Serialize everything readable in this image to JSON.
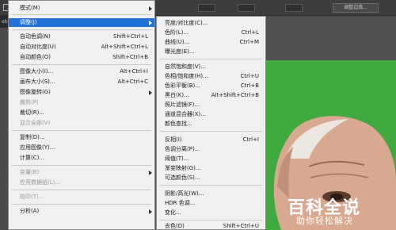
{
  "toolbar": {
    "adjust_edge_button": "调整边缘..."
  },
  "document_tab": {
    "title": "eb3b8a6ee2e5"
  },
  "watermark": {
    "title": "百科全说",
    "subtitle": "助你轻松解决"
  },
  "main_menu": {
    "items": [
      {
        "label": "模式(M)",
        "shortcut": "",
        "submenu": true
      },
      {
        "label": "调整(J)",
        "shortcut": "",
        "submenu": true
      },
      {
        "label": "自动色调(N)",
        "shortcut": "Shift+Ctrl+L"
      },
      {
        "label": "自动对比度(U)",
        "shortcut": "Alt+Shift+Ctrl+L"
      },
      {
        "label": "自动颜色(O)",
        "shortcut": "Shift+Ctrl+B"
      },
      {
        "label": "图像大小(I)...",
        "shortcut": "Alt+Ctrl+I"
      },
      {
        "label": "画布大小(S)...",
        "shortcut": "Alt+Ctrl+C"
      },
      {
        "label": "图像旋转(G)",
        "shortcut": "",
        "submenu": true
      },
      {
        "label": "裁剪(P)",
        "shortcut": ""
      },
      {
        "label": "裁切(R)...",
        "shortcut": ""
      },
      {
        "label": "显示全部(V)",
        "shortcut": ""
      },
      {
        "label": "复制(D)...",
        "shortcut": ""
      },
      {
        "label": "应用图像(Y)...",
        "shortcut": ""
      },
      {
        "label": "计算(C)...",
        "shortcut": ""
      },
      {
        "label": "变量(B)",
        "shortcut": "",
        "submenu": true
      },
      {
        "label": "应用数据组(L)...",
        "shortcut": ""
      },
      {
        "label": "陷印(T)...",
        "shortcut": ""
      },
      {
        "label": "分析(A)",
        "shortcut": "",
        "submenu": true
      }
    ]
  },
  "adjust_submenu": {
    "items": [
      {
        "label": "亮度/对比度(C)...",
        "shortcut": ""
      },
      {
        "label": "色阶(L)...",
        "shortcut": "Ctrl+L"
      },
      {
        "label": "曲线(U)...",
        "shortcut": "Ctrl+M"
      },
      {
        "label": "曝光度(E)...",
        "shortcut": ""
      },
      {
        "label": "自然饱和度(V)...",
        "shortcut": ""
      },
      {
        "label": "色相/饱和度(H)...",
        "shortcut": "Ctrl+U"
      },
      {
        "label": "色彩平衡(B)...",
        "shortcut": "Ctrl+B"
      },
      {
        "label": "黑白(K)...",
        "shortcut": "Alt+Shift+Ctrl+B"
      },
      {
        "label": "照片滤镜(F)...",
        "shortcut": ""
      },
      {
        "label": "通道混合器(X)...",
        "shortcut": ""
      },
      {
        "label": "颜色查找...",
        "shortcut": ""
      },
      {
        "label": "反相(I)",
        "shortcut": "Ctrl+I"
      },
      {
        "label": "色调分离(P)...",
        "shortcut": ""
      },
      {
        "label": "阈值(T)...",
        "shortcut": ""
      },
      {
        "label": "渐变映射(G)...",
        "shortcut": ""
      },
      {
        "label": "可选颜色(S)...",
        "shortcut": ""
      },
      {
        "label": "阴影/高光(W)...",
        "shortcut": ""
      },
      {
        "label": "HDR 色调...",
        "shortcut": ""
      },
      {
        "label": "变化...",
        "shortcut": ""
      },
      {
        "label": "去色(D)",
        "shortcut": "Shift+Ctrl+U"
      }
    ]
  }
}
